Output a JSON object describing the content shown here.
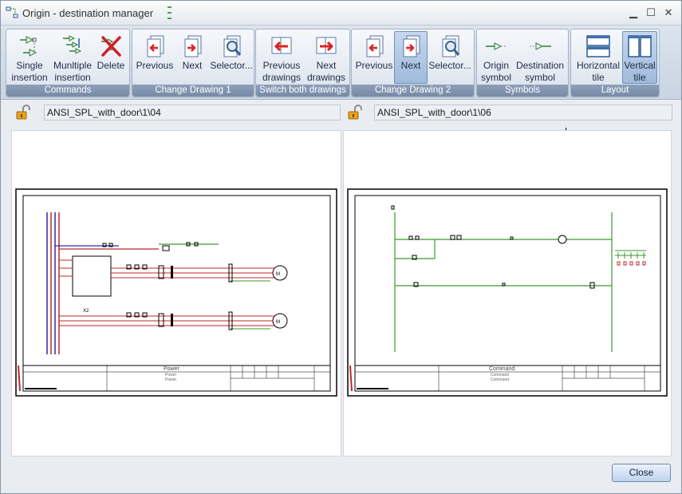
{
  "window": {
    "title": "Origin - destination manager",
    "minimize_glyph": "▁",
    "maximize_glyph": "☐",
    "close_glyph": "✕"
  },
  "ribbon": {
    "groups": [
      {
        "label": "Commands",
        "buttons": [
          {
            "label_line1": "Single",
            "label_line2": "insertion",
            "icon": "single-insertion-icon"
          },
          {
            "label_line1": "Munltiple",
            "label_line2": "insertion",
            "icon": "multiple-insertion-icon"
          },
          {
            "label_line1": "Delete",
            "label_line2": "",
            "icon": "delete-icon"
          }
        ]
      },
      {
        "label": "Change Drawing 1",
        "buttons": [
          {
            "label_line1": "Previous",
            "label_line2": "",
            "icon": "previous-page-icon"
          },
          {
            "label_line1": "Next",
            "label_line2": "",
            "icon": "next-page-icon"
          },
          {
            "label_line1": "Selector...",
            "label_line2": "",
            "icon": "selector-magnifier-icon"
          }
        ]
      },
      {
        "label": "Switch both drawings",
        "buttons": [
          {
            "label_line1": "Previous",
            "label_line2": "drawings",
            "icon": "previous-drawings-icon"
          },
          {
            "label_line1": "Next",
            "label_line2": "drawings",
            "icon": "next-drawings-icon"
          }
        ]
      },
      {
        "label": "Change Drawing 2",
        "buttons": [
          {
            "label_line1": "Previous",
            "label_line2": "",
            "icon": "previous-page-icon"
          },
          {
            "label_line1": "Next",
            "label_line2": "",
            "icon": "next-page-icon",
            "active": true
          },
          {
            "label_line1": "Selector...",
            "label_line2": "",
            "icon": "selector-magnifier-icon"
          }
        ]
      },
      {
        "label": "Symbols",
        "buttons": [
          {
            "label_line1": "Origin",
            "label_line2": "symbol",
            "icon": "origin-symbol-icon"
          },
          {
            "label_line1": "Destination",
            "label_line2": "symbol",
            "icon": "destination-symbol-icon"
          }
        ]
      },
      {
        "label": "Layout",
        "buttons": [
          {
            "label_line1": "Horizontal",
            "label_line2": "tile",
            "icon": "horizontal-tile-icon"
          },
          {
            "label_line1": "Vertical",
            "label_line2": "tile",
            "icon": "vertical-tile-icon",
            "active": true
          }
        ]
      }
    ]
  },
  "left_pane": {
    "path": "ANSI_SPL_with_door\\1\\04",
    "lock_state": "unlocked",
    "titleblock": {
      "title": "Power",
      "line2": "Power",
      "line3": "Power"
    }
  },
  "right_pane": {
    "path": "ANSI_SPL_with_door\\1\\06",
    "lock_state": "unlocked",
    "titleblock": {
      "title": "Command",
      "line2": "Command",
      "line3": "Command"
    }
  },
  "footer": {
    "close_label": "Close"
  },
  "colors": {
    "phase_red": "#c0282a",
    "phase_blue": "#2a2ab0",
    "neutral_green": "#3a9a2a",
    "ribbon_group_label": "#7f93ae",
    "active_button": "#a9c1df"
  }
}
